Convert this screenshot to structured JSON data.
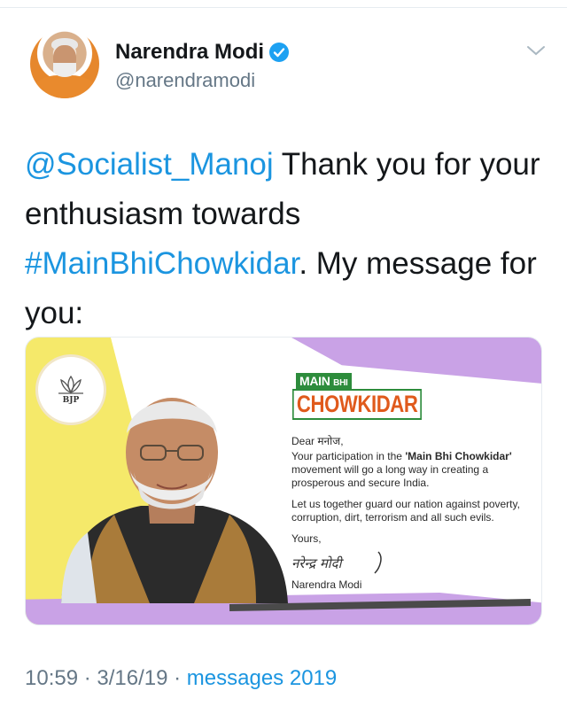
{
  "author": {
    "display_name": "Narendra Modi",
    "handle": "@narendramodi",
    "verified": true
  },
  "tweet": {
    "mention": "@Socialist_Manoj",
    "text_1": " Thank you for your enthusiasm towards ",
    "hashtag": "#MainBhiChowkidar",
    "text_2": ". My message for you:"
  },
  "card": {
    "logo_text": "BJP",
    "badge_main": "MAIN",
    "badge_bhi": "BHI",
    "badge_word": "CHOWKIDAR",
    "greeting": "Dear मनोज,",
    "para_1": "Your participation in the ",
    "para_1_bold": "'Main Bhi Chowkidar'",
    "para_1_end": " movement will go a long way in creating a prosperous and secure India.",
    "para_2": "Let us together guard our nation against poverty, corruption, dirt, terrorism and all such evils.",
    "closing": "Yours,",
    "signature_script": "नरेन्द्र मोदी",
    "signed_name": "Narendra Modi"
  },
  "footer": {
    "time": "10:59",
    "sep1": " · ",
    "date": "3/16/19",
    "sep2": " · ",
    "source": "messages 2019"
  },
  "colors": {
    "link": "#1b95e0",
    "verified": "#1da1f2",
    "muted": "#657786",
    "card_yellow": "#f5e96a",
    "card_purple": "#c9a2e6",
    "chowkidar_green": "#2d8c3c",
    "chowkidar_orange": "#e05a1c"
  },
  "icons": [
    "verified-badge-icon",
    "chevron-down-icon",
    "bjp-lotus-icon"
  ]
}
